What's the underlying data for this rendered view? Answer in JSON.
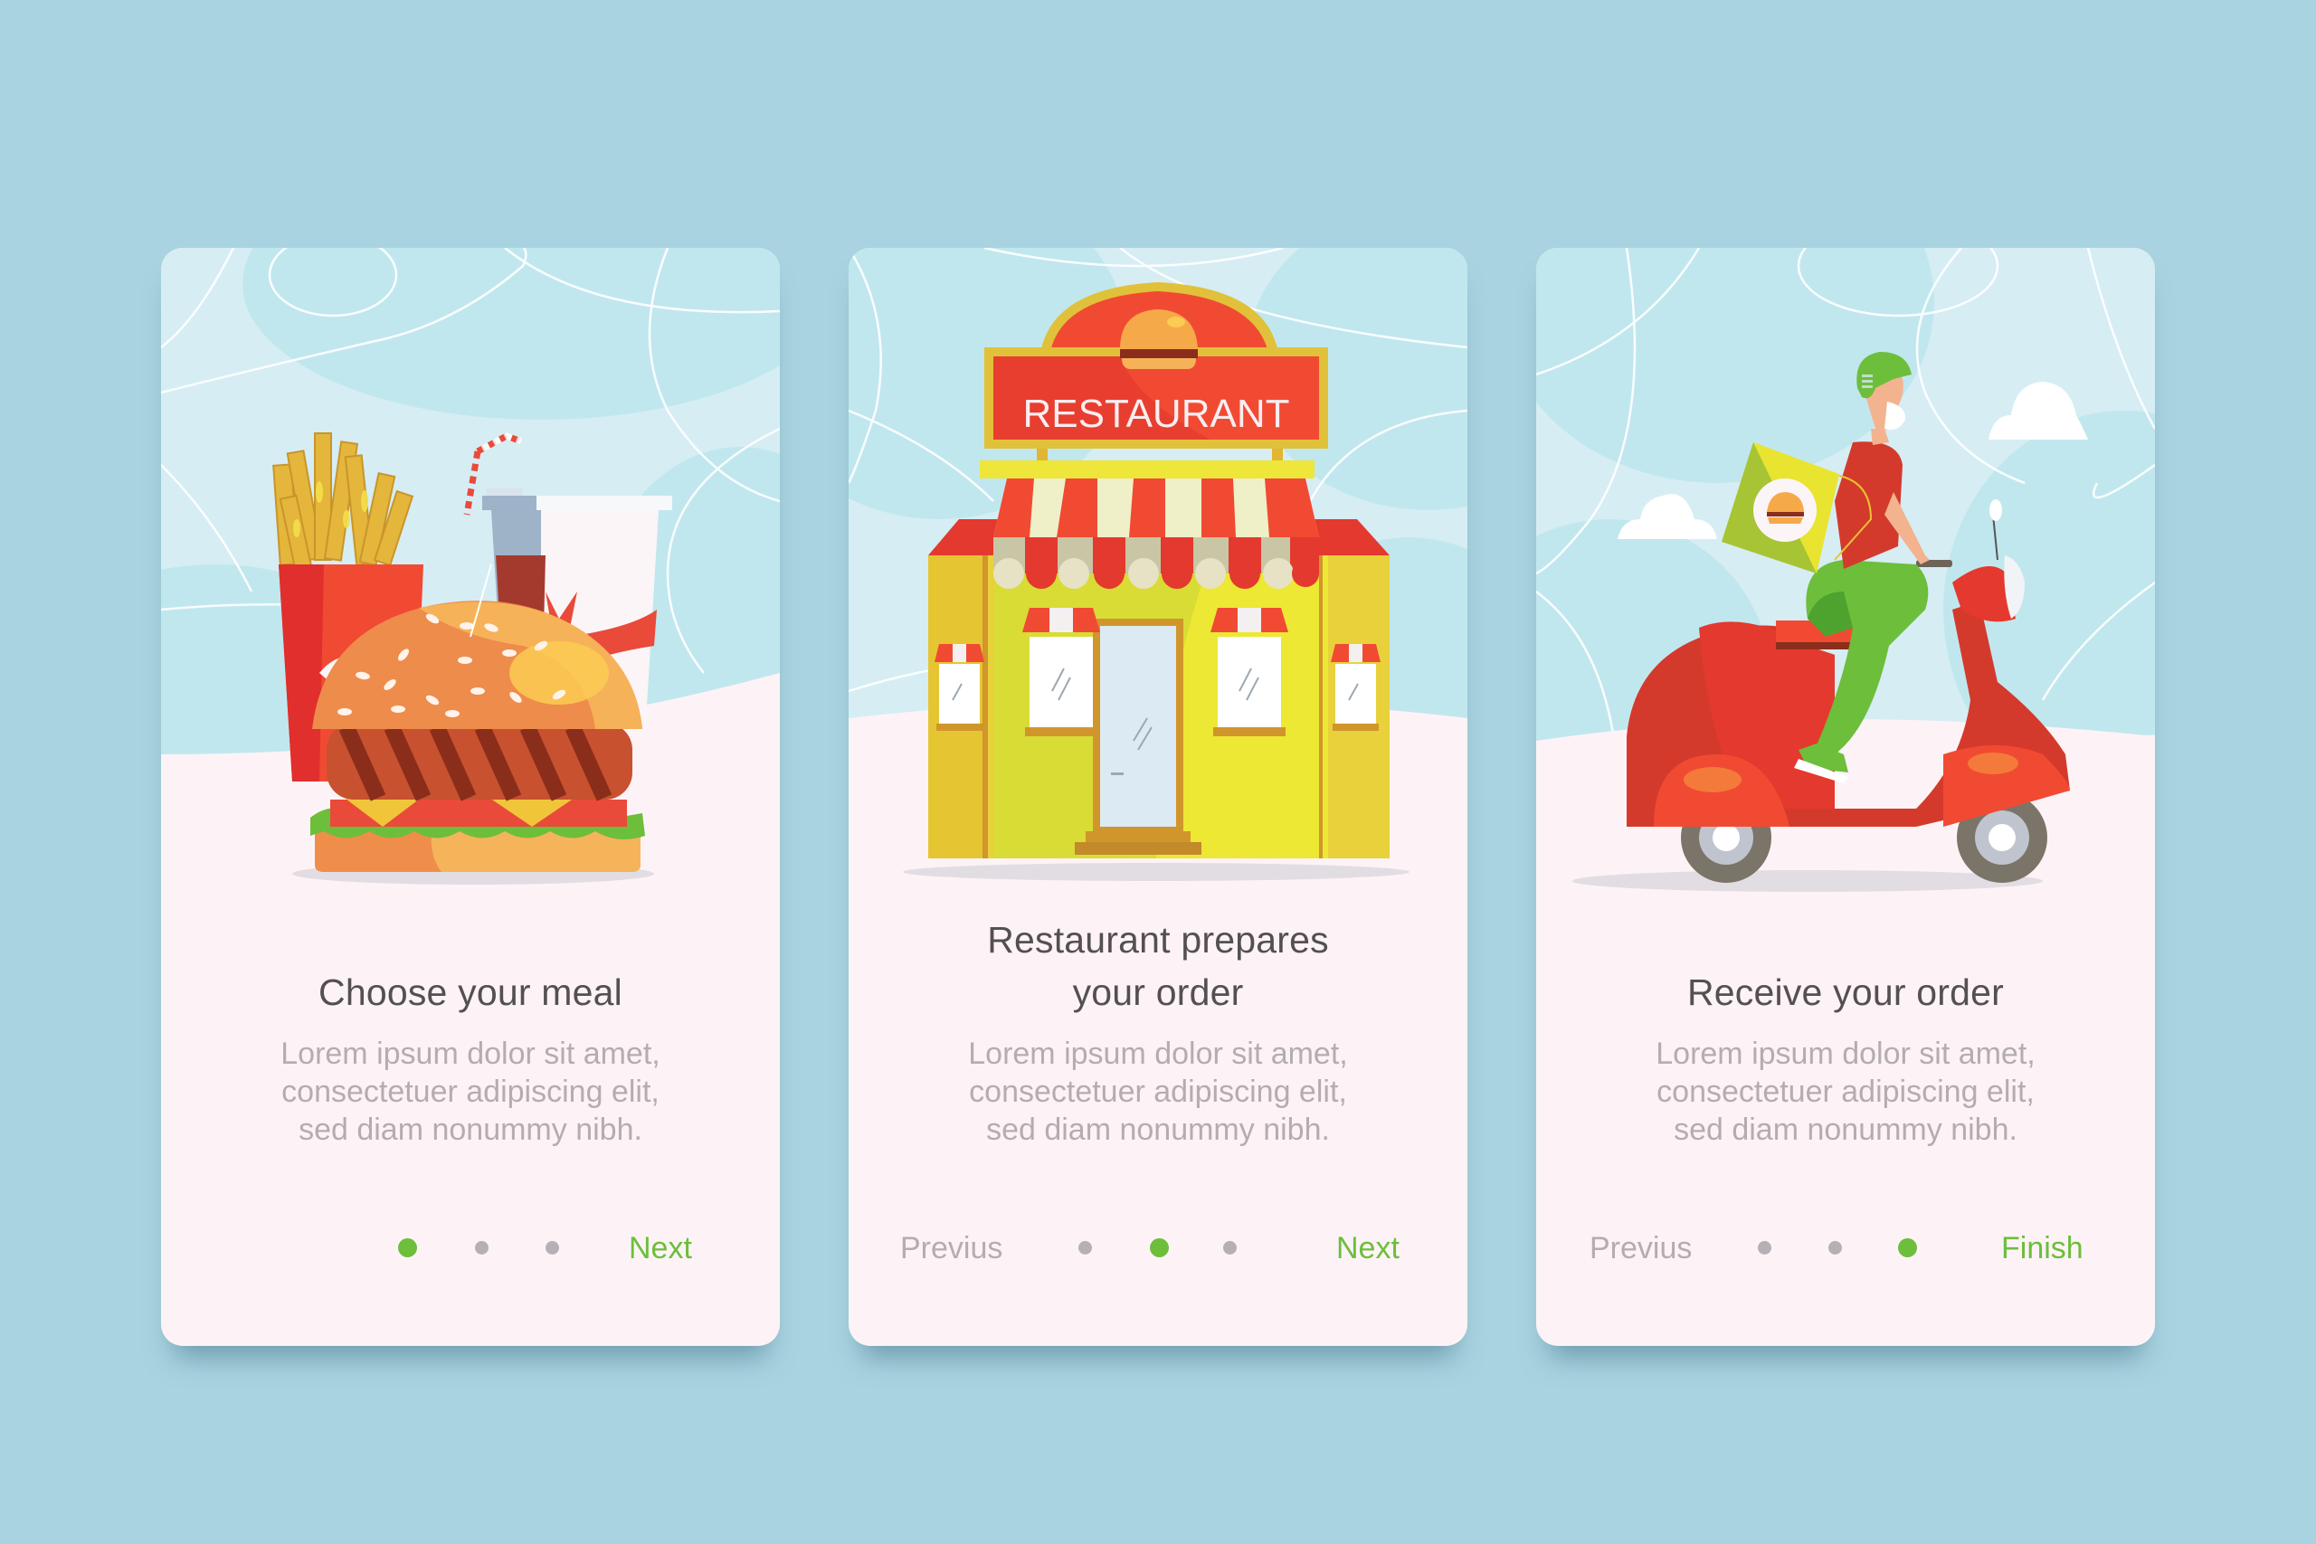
{
  "background_color": "#A9D3E0",
  "accent_color": "#6DBE3B",
  "inactive_color": "#B5B0B5",
  "cards": [
    {
      "step": 1,
      "illustration": "burger-fries-drink",
      "title_lines": [
        "Choose your meal"
      ],
      "body_lines": [
        "Lorem ipsum dolor sit amet,",
        "consectetuer adipiscing elit,",
        "sed diam nonummy nibh."
      ],
      "previous_label": null,
      "next_label": "Next",
      "active_dot": 1,
      "dot_count": 3
    },
    {
      "step": 2,
      "illustration": "restaurant-storefront",
      "sign_text": "RESTAURANT",
      "title_lines": [
        "Restaurant prepares",
        "your order"
      ],
      "body_lines": [
        "Lorem ipsum dolor sit amet,",
        "consectetuer adipiscing elit,",
        "sed diam nonummy nibh."
      ],
      "previous_label": "Previus",
      "next_label": "Next",
      "active_dot": 2,
      "dot_count": 3
    },
    {
      "step": 3,
      "illustration": "delivery-scooter-rider",
      "title_lines": [
        "Receive your order"
      ],
      "body_lines": [
        "Lorem ipsum dolor sit amet,",
        "consectetuer adipiscing elit,",
        "sed diam nonummy nibh."
      ],
      "previous_label": "Previus",
      "next_label": "Finish",
      "active_dot": 3,
      "dot_count": 3
    }
  ]
}
